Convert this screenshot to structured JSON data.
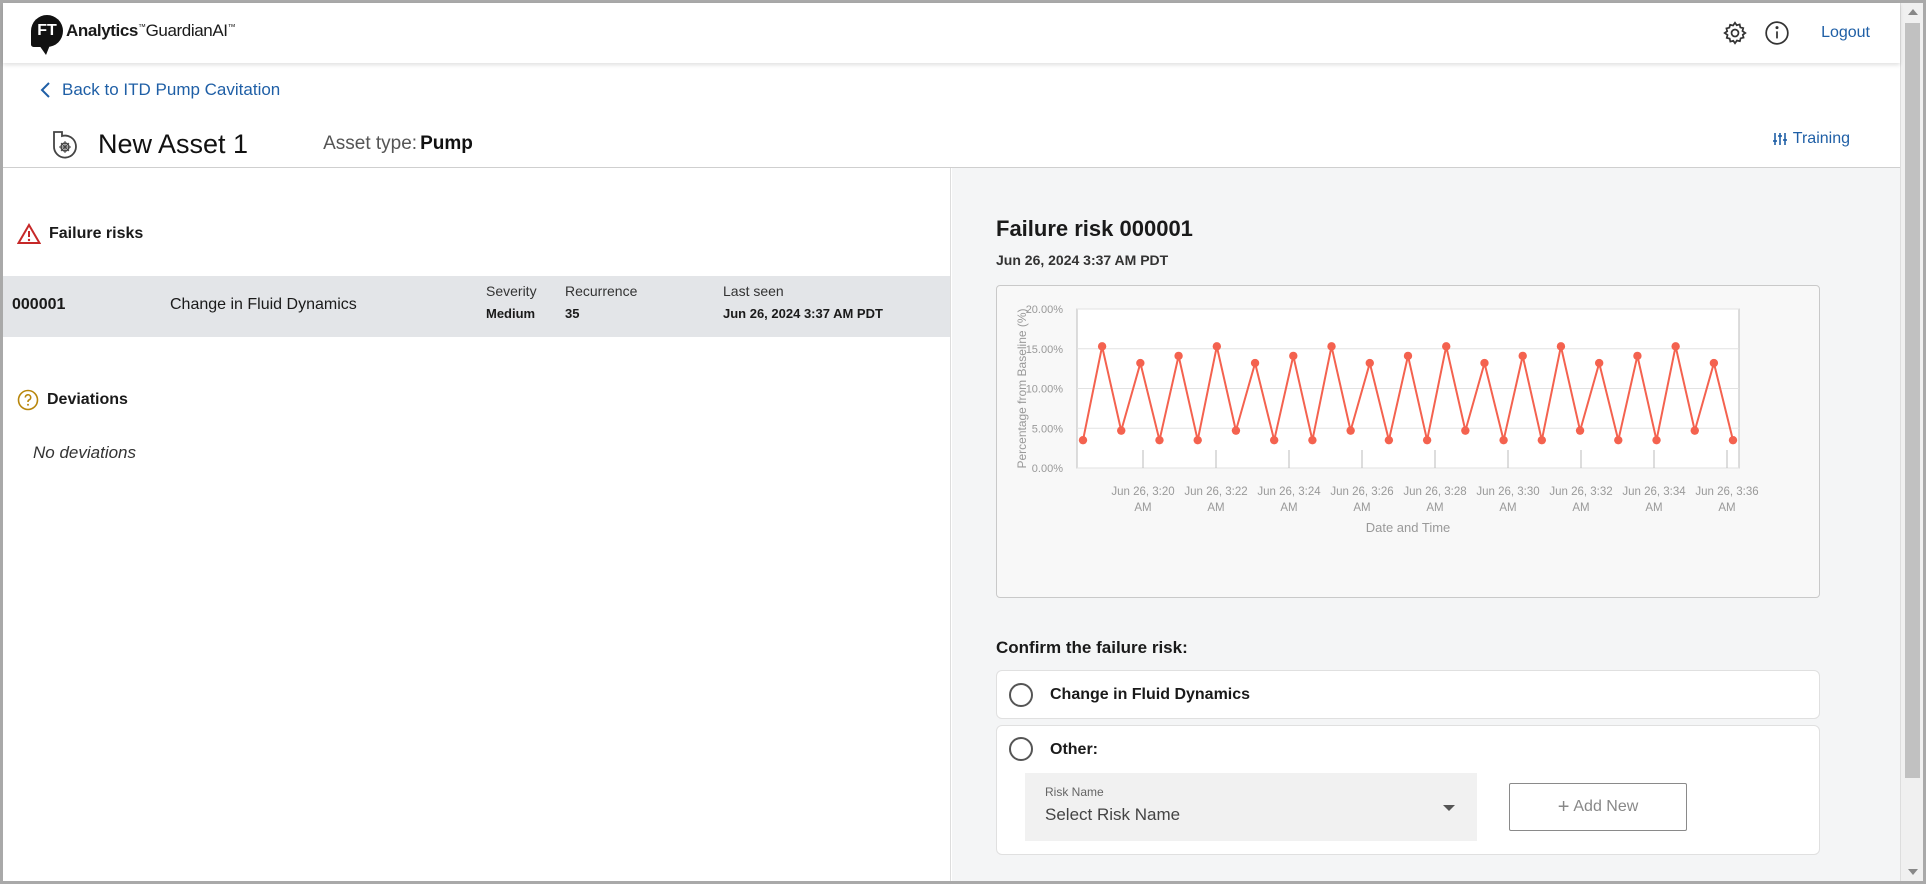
{
  "header": {
    "logo_badge": "FT",
    "logo_brand": "Analytics",
    "logo_product": "GuardianAI",
    "logout_label": "Logout"
  },
  "nav": {
    "back_label": "Back to ITD Pump Cavitation"
  },
  "asset": {
    "title": "New Asset 1",
    "type_label": "Asset type:",
    "type_value": "Pump",
    "training_label": "Training"
  },
  "failure_risks": {
    "heading": "Failure risks",
    "rows": [
      {
        "id": "000001",
        "name": "Change in Fluid Dynamics",
        "severity_label": "Severity",
        "severity": "Medium",
        "recurrence_label": "Recurrence",
        "recurrence": "35",
        "last_seen_label": "Last seen",
        "last_seen": "Jun 26, 2024 3:37 AM PDT"
      }
    ]
  },
  "deviations": {
    "heading": "Deviations",
    "empty_text": "No deviations"
  },
  "detail": {
    "title": "Failure risk 000001",
    "date": "Jun 26, 2024 3:37 AM PDT",
    "confirm_heading": "Confirm the failure risk:",
    "option_1": "Change in Fluid Dynamics",
    "option_2": "Other:",
    "risk_name_label": "Risk Name",
    "risk_name_placeholder": "Select Risk Name",
    "add_new_label": "Add New"
  },
  "colors": {
    "accent": "#1f5fa6",
    "series": "#f4624f",
    "warning": "#c62828",
    "deviation": "#b8860b"
  },
  "chart_data": {
    "type": "line",
    "title": "",
    "xlabel": "Date and Time",
    "ylabel": "Percentage from Baseline (%)",
    "ylim": [
      0,
      20
    ],
    "y_ticks": [
      "0.00%",
      "5.00%",
      "10.00%",
      "15.00%",
      "20.00%"
    ],
    "x_ticks": [
      [
        "Jun 26, 3:20",
        "AM"
      ],
      [
        "Jun 26, 3:22",
        "AM"
      ],
      [
        "Jun 26, 3:24",
        "AM"
      ],
      [
        "Jun 26, 3:26",
        "AM"
      ],
      [
        "Jun 26, 3:28",
        "AM"
      ],
      [
        "Jun 26, 3:30",
        "AM"
      ],
      [
        "Jun 26, 3:32",
        "AM"
      ],
      [
        "Jun 26, 3:34",
        "AM"
      ],
      [
        "Jun 26, 3:36",
        "AM"
      ]
    ],
    "grid": true,
    "series": [
      {
        "values": [
          3.5,
          15.3,
          4.7,
          13.2,
          3.5,
          14.1,
          3.5,
          15.3,
          4.7,
          13.2,
          3.5,
          14.1,
          3.5,
          15.3,
          4.7,
          13.2,
          3.5,
          14.1,
          3.5,
          15.3,
          4.7,
          13.2,
          3.5,
          14.1,
          3.5,
          15.3,
          4.7,
          13.2,
          3.5,
          14.1,
          3.5,
          15.3,
          4.7,
          13.2,
          3.5
        ]
      }
    ]
  }
}
